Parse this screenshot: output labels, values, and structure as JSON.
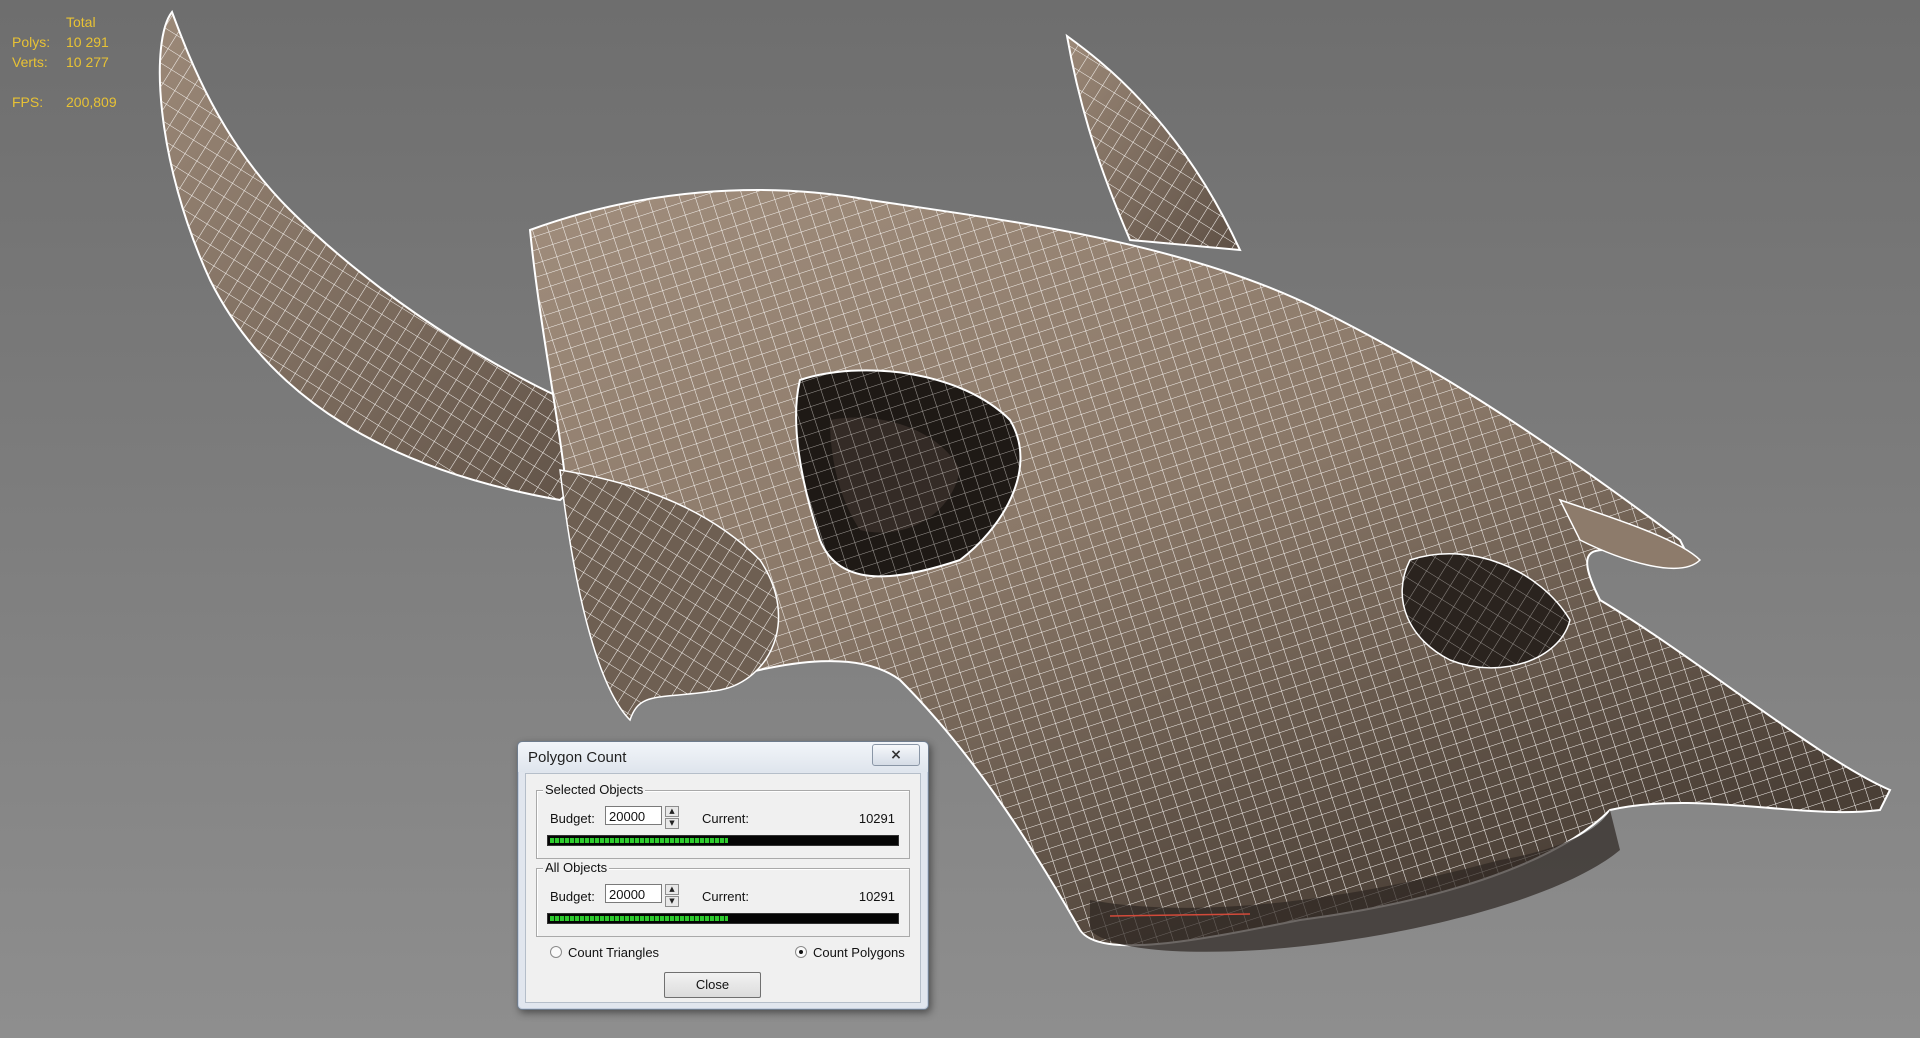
{
  "viewport": {
    "stats": {
      "header": "Total",
      "polys_label": "Polys:",
      "polys_value": "10 291",
      "verts_label": "Verts:",
      "verts_value": "10 277",
      "fps_label": "FPS:",
      "fps_value": "200,809"
    },
    "model": "bull-skull-wireframe"
  },
  "dialog": {
    "title": "Polygon Count",
    "close_icon": "×",
    "selected": {
      "legend": "Selected Objects",
      "budget_label": "Budget:",
      "budget_value": "20000",
      "current_label": "Current:",
      "current_value": "10291",
      "progress": 0.5146
    },
    "all": {
      "legend": "All Objects",
      "budget_label": "Budget:",
      "budget_value": "20000",
      "current_label": "Current:",
      "current_value": "10291",
      "progress": 0.5146
    },
    "count_triangles_label": "Count Triangles",
    "count_polygons_label": "Count Polygons",
    "selected_mode": "polygons",
    "close_label": "Close"
  },
  "colors": {
    "stats_text": "#e8c234",
    "mesh_fill": "#8c7a6a",
    "wire": "#ffffff",
    "progress_green": "#2ecc2e"
  }
}
